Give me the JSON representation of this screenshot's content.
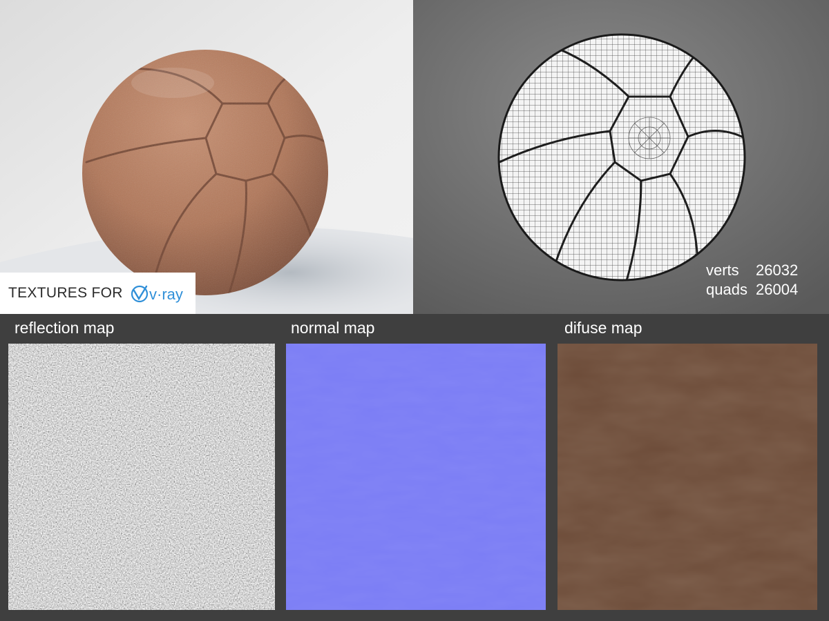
{
  "badge": {
    "text": "TEXTURES FOR",
    "logo_text": "v·ray"
  },
  "stats": {
    "verts_label": "verts",
    "verts_value": "26032",
    "quads_label": "quads",
    "quads_value": "26004"
  },
  "maps": [
    {
      "label": "reflection map"
    },
    {
      "label": "normal map"
    },
    {
      "label": "difuse map"
    }
  ],
  "colors": {
    "background": "#3f3f3f",
    "leather": "#b57a5c",
    "normal_map": "#7b7df5",
    "diffuse_map": "#6c4b38"
  }
}
